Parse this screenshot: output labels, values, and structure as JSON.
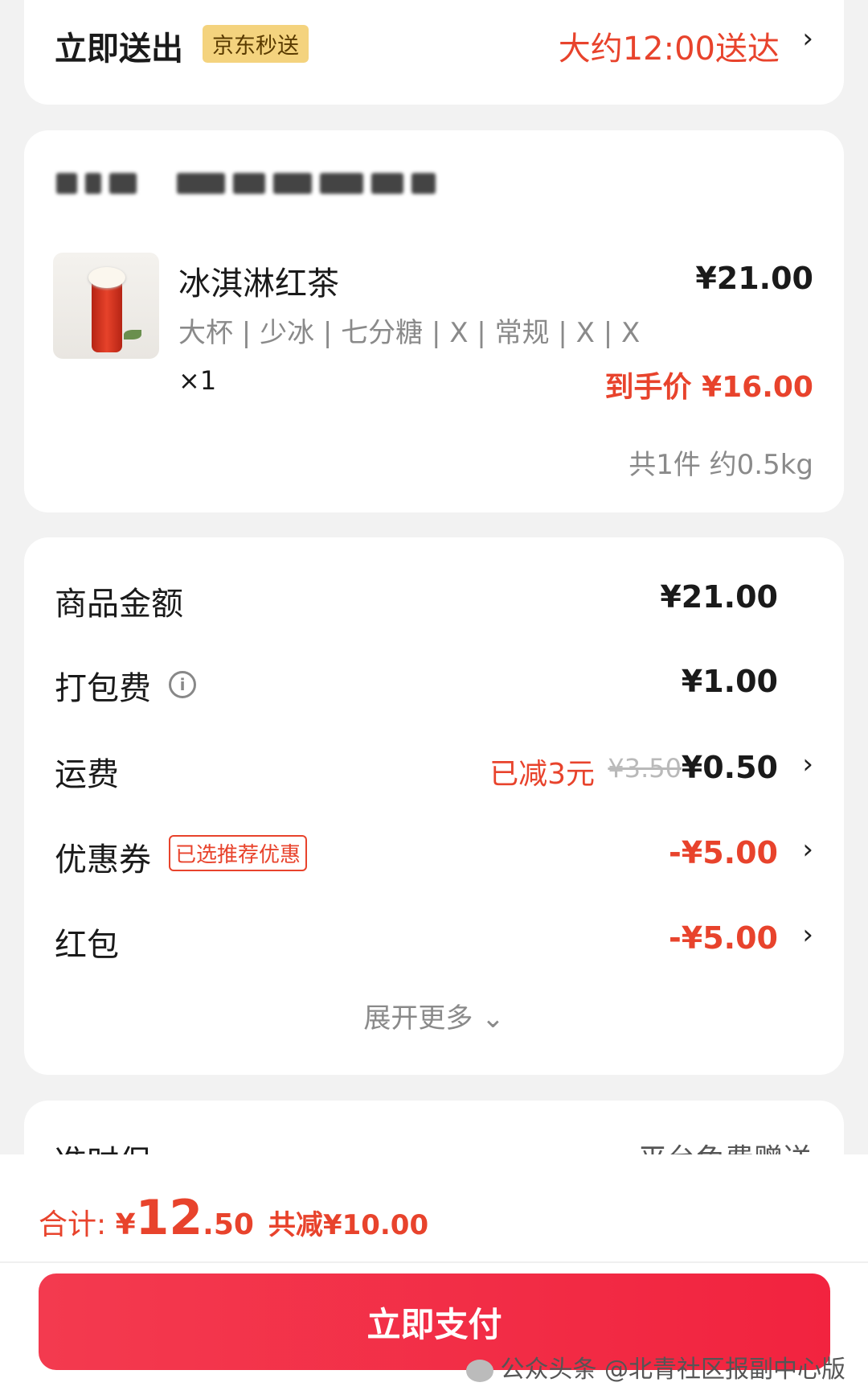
{
  "delivery": {
    "title": "立即送出",
    "badge": "京东秒送",
    "time": "大约12:00送达",
    "chevron": "›"
  },
  "product": {
    "name": "冰淇淋红茶",
    "price": "¥21.00",
    "spec": "大杯 | 少冰 | 七分糖 | X | 常规 | X | X",
    "qty": "×1",
    "final_price": "到手价 ¥16.00",
    "total_info": "共1件 约0.5kg"
  },
  "fees": {
    "goods_label": "商品金额",
    "goods_value": "¥21.00",
    "pack_label": "打包费",
    "pack_value": "¥1.00",
    "info_glyph": "i",
    "shipping_label": "运费",
    "shipping_reduced": "已减3元",
    "shipping_original": "¥3.50",
    "shipping_value": "¥0.50",
    "coupon_label": "优惠券",
    "coupon_tag": "已选推荐优惠",
    "coupon_value": "-¥5.00",
    "redpacket_label": "红包",
    "redpacket_value": "-¥5.00",
    "expand_label": "展开更多 ⌄",
    "chevron": "›"
  },
  "next_card": {
    "left": "准时保",
    "right": "平台免费赠送"
  },
  "bottom": {
    "sum_label": "合计: ",
    "currency": "¥",
    "sum_int": "12",
    "sum_dec": ".50",
    "saved": "共减¥10.00",
    "pay_label": "立即支付",
    "watermark": "公众头条 @北青社区报副中心版"
  },
  "colors": {
    "accent_red": "#e8432c",
    "pay_button": "#f2233f",
    "badge_yellow": "#f4d37e"
  }
}
